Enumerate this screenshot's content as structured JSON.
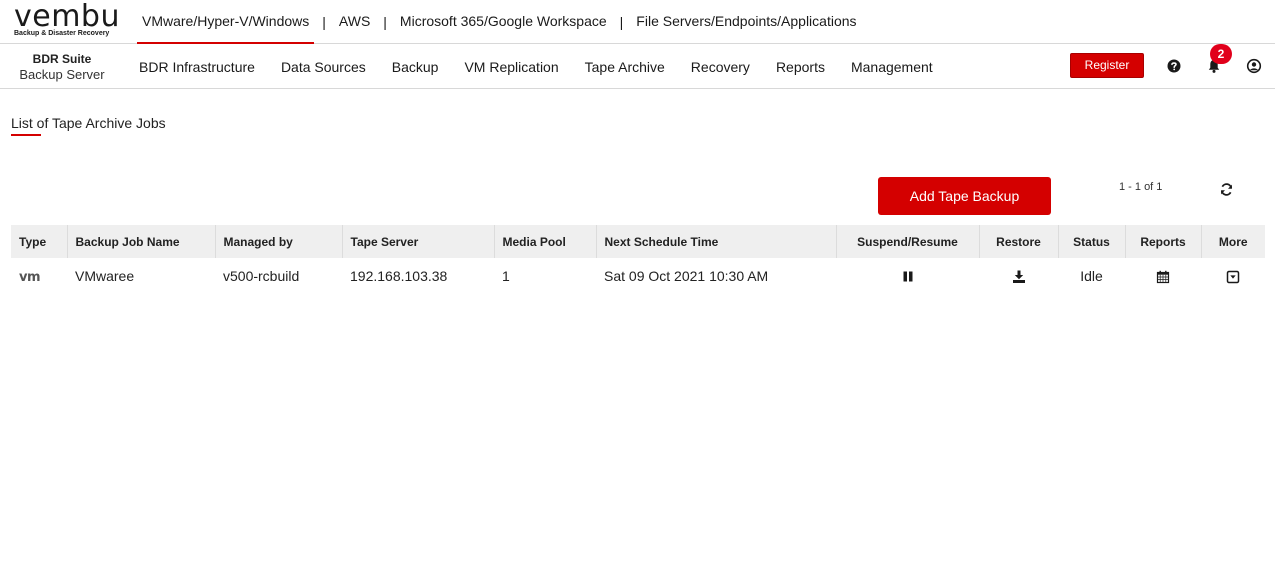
{
  "brand": {
    "logo_text": "vembu",
    "logo_tagline": "Backup & Disaster Recovery"
  },
  "product_tabs": [
    {
      "label": "VMware/Hyper-V/Windows",
      "active": true
    },
    {
      "label": "AWS",
      "active": false
    },
    {
      "label": "Microsoft 365/Google Workspace",
      "active": false
    },
    {
      "label": "File Servers/Endpoints/Applications",
      "active": false
    }
  ],
  "suite": {
    "title": "BDR Suite",
    "subtitle": "Backup Server"
  },
  "nav": [
    "BDR Infrastructure",
    "Data Sources",
    "Backup",
    "VM Replication",
    "Tape Archive",
    "Recovery",
    "Reports",
    "Management"
  ],
  "header_actions": {
    "register_label": "Register",
    "notification_count": "2",
    "icons": [
      "help-icon",
      "bell-icon",
      "user-icon"
    ]
  },
  "page": {
    "title": "List of Tape Archive Jobs",
    "add_button_label": "Add Tape Backup",
    "pagination": "1 - 1 of 1"
  },
  "table": {
    "headers": [
      "Type",
      "Backup Job Name",
      "Managed by",
      "Tape Server",
      "Media Pool",
      "Next Schedule Time",
      "Suspend/Resume",
      "Restore",
      "Status",
      "Reports",
      "More"
    ],
    "rows": [
      {
        "type": "vm",
        "job_name": "VMwaree",
        "managed_by": "v500-rcbuild",
        "tape_server": "192.168.103.38",
        "media_pool": "1",
        "next_schedule": "Sat 09 Oct 2021 10:30 AM",
        "suspend_icon": "pause-icon",
        "restore_icon": "download-icon",
        "status": "Idle",
        "reports_icon": "calendar-icon",
        "more_icon": "dropdown-box-icon"
      }
    ]
  },
  "colors": {
    "accent": "#d40000",
    "badge": "#e1001b",
    "table_header_bg": "#efefef"
  }
}
